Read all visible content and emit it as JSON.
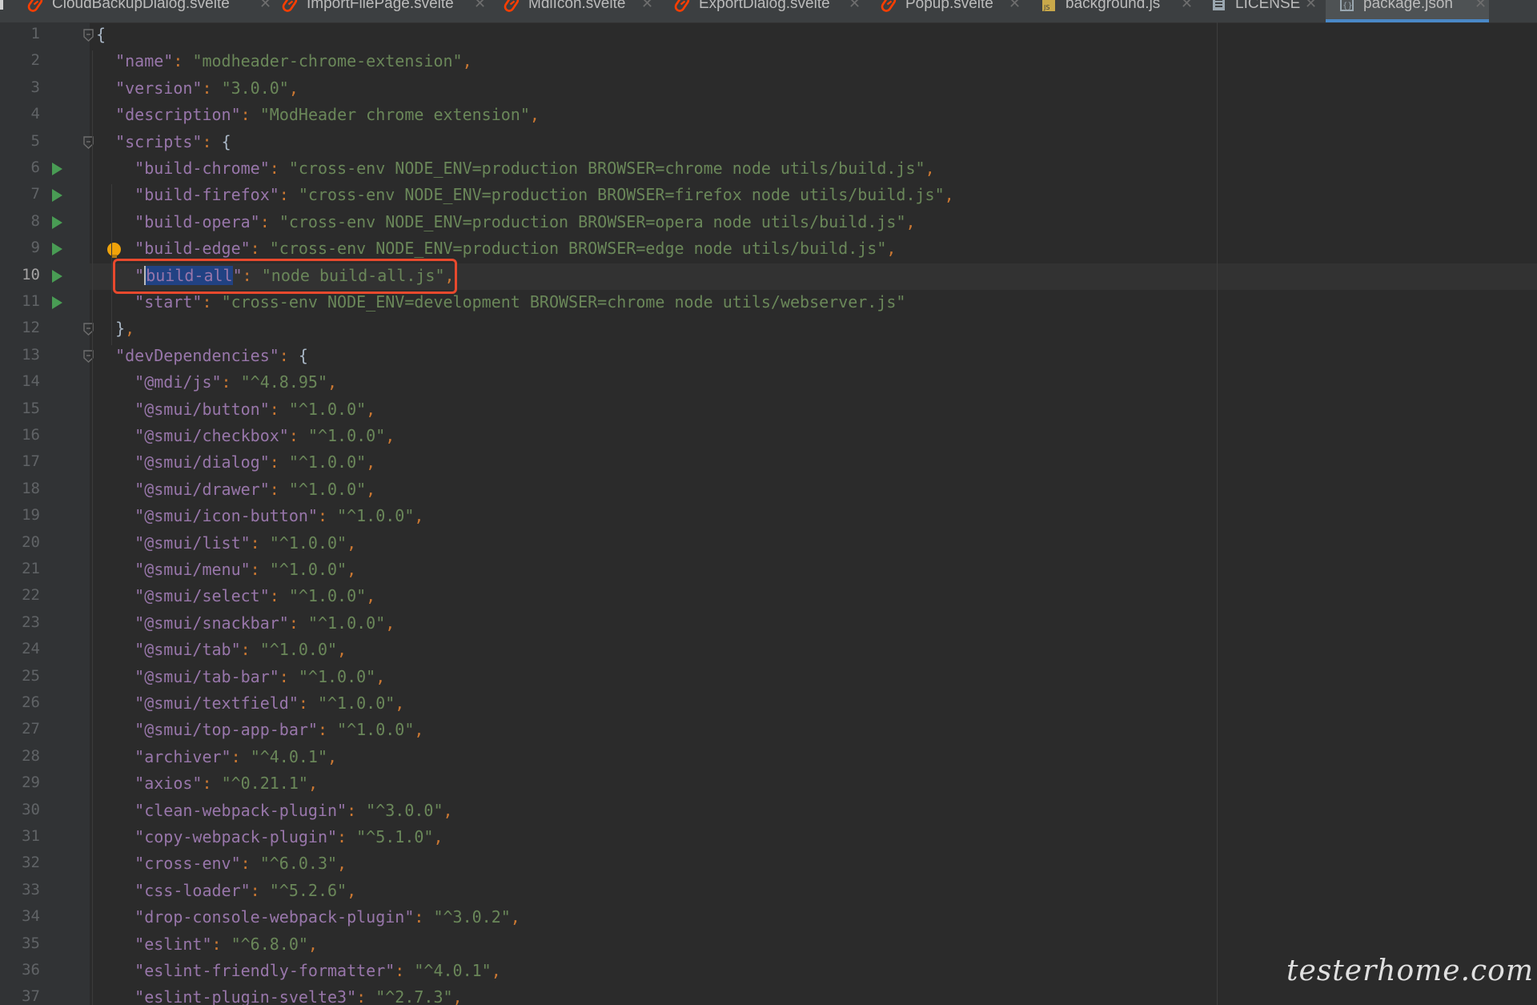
{
  "tabs": [
    {
      "label": "CloudBackupDialog.svelte",
      "icon": "svelte-icon",
      "active": false
    },
    {
      "label": "ImportFilePage.svelte",
      "icon": "svelte-icon",
      "active": false
    },
    {
      "label": "MdiIcon.svelte",
      "icon": "svelte-icon",
      "active": false
    },
    {
      "label": "ExportDialog.svelte",
      "icon": "svelte-icon",
      "active": false
    },
    {
      "label": "Popup.svelte",
      "icon": "svelte-icon",
      "active": false
    },
    {
      "label": "background.js",
      "icon": "javascript-file-icon",
      "active": false
    },
    {
      "label": "LICENSE",
      "icon": "text-file-icon",
      "active": false
    },
    {
      "label": "package.json",
      "icon": "json-file-icon",
      "active": true
    }
  ],
  "editor": {
    "current_line": 10,
    "selected_text": "build-all",
    "highlighted_line": 10,
    "lines": [
      {
        "n": "1",
        "fold": true,
        "tokens": [
          [
            "b",
            "{"
          ]
        ]
      },
      {
        "n": "2",
        "tokens": [
          [
            "i",
            "  "
          ],
          [
            "k",
            "\"name\""
          ],
          [
            "p",
            ": "
          ],
          [
            "s",
            "\"modheader-chrome-extension\""
          ],
          [
            "p",
            ","
          ]
        ]
      },
      {
        "n": "3",
        "tokens": [
          [
            "i",
            "  "
          ],
          [
            "k",
            "\"version\""
          ],
          [
            "p",
            ": "
          ],
          [
            "s",
            "\"3.0.0\""
          ],
          [
            "p",
            ","
          ]
        ]
      },
      {
        "n": "4",
        "tokens": [
          [
            "i",
            "  "
          ],
          [
            "k",
            "\"description\""
          ],
          [
            "p",
            ": "
          ],
          [
            "s",
            "\"ModHeader chrome extension\""
          ],
          [
            "p",
            ","
          ]
        ]
      },
      {
        "n": "5",
        "fold": true,
        "tokens": [
          [
            "i",
            "  "
          ],
          [
            "k",
            "\"scripts\""
          ],
          [
            "p",
            ": "
          ],
          [
            "b",
            "{"
          ]
        ]
      },
      {
        "n": "6",
        "run": true,
        "tokens": [
          [
            "i",
            "    "
          ],
          [
            "k",
            "\"build-chrome\""
          ],
          [
            "p",
            ": "
          ],
          [
            "s",
            "\"cross-env NODE_ENV=production BROWSER=chrome node utils/build.js\""
          ],
          [
            "p",
            ","
          ]
        ]
      },
      {
        "n": "7",
        "run": true,
        "tokens": [
          [
            "i",
            "    "
          ],
          [
            "k",
            "\"build-firefox\""
          ],
          [
            "p",
            ": "
          ],
          [
            "s",
            "\"cross-env NODE_ENV=production BROWSER=firefox node utils/build.js\""
          ],
          [
            "p",
            ","
          ]
        ]
      },
      {
        "n": "8",
        "run": true,
        "tokens": [
          [
            "i",
            "    "
          ],
          [
            "k",
            "\"build-opera\""
          ],
          [
            "p",
            ": "
          ],
          [
            "s",
            "\"cross-env NODE_ENV=production BROWSER=opera node utils/build.js\""
          ],
          [
            "p",
            ","
          ]
        ]
      },
      {
        "n": "9",
        "run": true,
        "bulb": true,
        "tokens": [
          [
            "i",
            "    "
          ],
          [
            "k",
            "\"build-edge\""
          ],
          [
            "p",
            ": "
          ],
          [
            "s",
            "\"cross-env NODE_ENV=production BROWSER=edge node utils/build.js\""
          ],
          [
            "p",
            ","
          ]
        ]
      },
      {
        "n": "10",
        "run": true,
        "tokens": [
          [
            "i",
            "    "
          ],
          [
            "k",
            "\""
          ],
          [
            "sel",
            "build-all"
          ],
          [
            "k",
            "\""
          ],
          [
            "p",
            ": "
          ],
          [
            "s",
            "\"node build-all.js\""
          ],
          [
            "p",
            ","
          ]
        ]
      },
      {
        "n": "11",
        "run": true,
        "tokens": [
          [
            "i",
            "    "
          ],
          [
            "k",
            "\"start\""
          ],
          [
            "p",
            ": "
          ],
          [
            "s",
            "\"cross-env NODE_ENV=development BROWSER=chrome node utils/webserver.js\""
          ]
        ]
      },
      {
        "n": "12",
        "fold": true,
        "tokens": [
          [
            "i",
            "  "
          ],
          [
            "b",
            "}"
          ],
          [
            "p",
            ","
          ]
        ]
      },
      {
        "n": "13",
        "fold": true,
        "tokens": [
          [
            "i",
            "  "
          ],
          [
            "k",
            "\"devDependencies\""
          ],
          [
            "p",
            ": "
          ],
          [
            "b",
            "{"
          ]
        ]
      },
      {
        "n": "14",
        "tokens": [
          [
            "i",
            "    "
          ],
          [
            "k",
            "\"@mdi/js\""
          ],
          [
            "p",
            ": "
          ],
          [
            "s",
            "\"^4.8.95\""
          ],
          [
            "p",
            ","
          ]
        ]
      },
      {
        "n": "15",
        "tokens": [
          [
            "i",
            "    "
          ],
          [
            "k",
            "\"@smui/button\""
          ],
          [
            "p",
            ": "
          ],
          [
            "s",
            "\"^1.0.0\""
          ],
          [
            "p",
            ","
          ]
        ]
      },
      {
        "n": "16",
        "tokens": [
          [
            "i",
            "    "
          ],
          [
            "k",
            "\"@smui/checkbox\""
          ],
          [
            "p",
            ": "
          ],
          [
            "s",
            "\"^1.0.0\""
          ],
          [
            "p",
            ","
          ]
        ]
      },
      {
        "n": "17",
        "tokens": [
          [
            "i",
            "    "
          ],
          [
            "k",
            "\"@smui/dialog\""
          ],
          [
            "p",
            ": "
          ],
          [
            "s",
            "\"^1.0.0\""
          ],
          [
            "p",
            ","
          ]
        ]
      },
      {
        "n": "18",
        "tokens": [
          [
            "i",
            "    "
          ],
          [
            "k",
            "\"@smui/drawer\""
          ],
          [
            "p",
            ": "
          ],
          [
            "s",
            "\"^1.0.0\""
          ],
          [
            "p",
            ","
          ]
        ]
      },
      {
        "n": "19",
        "tokens": [
          [
            "i",
            "    "
          ],
          [
            "k",
            "\"@smui/icon-button\""
          ],
          [
            "p",
            ": "
          ],
          [
            "s",
            "\"^1.0.0\""
          ],
          [
            "p",
            ","
          ]
        ]
      },
      {
        "n": "20",
        "tokens": [
          [
            "i",
            "    "
          ],
          [
            "k",
            "\"@smui/list\""
          ],
          [
            "p",
            ": "
          ],
          [
            "s",
            "\"^1.0.0\""
          ],
          [
            "p",
            ","
          ]
        ]
      },
      {
        "n": "21",
        "tokens": [
          [
            "i",
            "    "
          ],
          [
            "k",
            "\"@smui/menu\""
          ],
          [
            "p",
            ": "
          ],
          [
            "s",
            "\"^1.0.0\""
          ],
          [
            "p",
            ","
          ]
        ]
      },
      {
        "n": "22",
        "tokens": [
          [
            "i",
            "    "
          ],
          [
            "k",
            "\"@smui/select\""
          ],
          [
            "p",
            ": "
          ],
          [
            "s",
            "\"^1.0.0\""
          ],
          [
            "p",
            ","
          ]
        ]
      },
      {
        "n": "23",
        "tokens": [
          [
            "i",
            "    "
          ],
          [
            "k",
            "\"@smui/snackbar\""
          ],
          [
            "p",
            ": "
          ],
          [
            "s",
            "\"^1.0.0\""
          ],
          [
            "p",
            ","
          ]
        ]
      },
      {
        "n": "24",
        "tokens": [
          [
            "i",
            "    "
          ],
          [
            "k",
            "\"@smui/tab\""
          ],
          [
            "p",
            ": "
          ],
          [
            "s",
            "\"^1.0.0\""
          ],
          [
            "p",
            ","
          ]
        ]
      },
      {
        "n": "25",
        "tokens": [
          [
            "i",
            "    "
          ],
          [
            "k",
            "\"@smui/tab-bar\""
          ],
          [
            "p",
            ": "
          ],
          [
            "s",
            "\"^1.0.0\""
          ],
          [
            "p",
            ","
          ]
        ]
      },
      {
        "n": "26",
        "tokens": [
          [
            "i",
            "    "
          ],
          [
            "k",
            "\"@smui/textfield\""
          ],
          [
            "p",
            ": "
          ],
          [
            "s",
            "\"^1.0.0\""
          ],
          [
            "p",
            ","
          ]
        ]
      },
      {
        "n": "27",
        "tokens": [
          [
            "i",
            "    "
          ],
          [
            "k",
            "\"@smui/top-app-bar\""
          ],
          [
            "p",
            ": "
          ],
          [
            "s",
            "\"^1.0.0\""
          ],
          [
            "p",
            ","
          ]
        ]
      },
      {
        "n": "28",
        "tokens": [
          [
            "i",
            "    "
          ],
          [
            "k",
            "\"archiver\""
          ],
          [
            "p",
            ": "
          ],
          [
            "s",
            "\"^4.0.1\""
          ],
          [
            "p",
            ","
          ]
        ]
      },
      {
        "n": "29",
        "tokens": [
          [
            "i",
            "    "
          ],
          [
            "k",
            "\"axios\""
          ],
          [
            "p",
            ": "
          ],
          [
            "s",
            "\"^0.21.1\""
          ],
          [
            "p",
            ","
          ]
        ]
      },
      {
        "n": "30",
        "tokens": [
          [
            "i",
            "    "
          ],
          [
            "k",
            "\"clean-webpack-plugin\""
          ],
          [
            "p",
            ": "
          ],
          [
            "s",
            "\"^3.0.0\""
          ],
          [
            "p",
            ","
          ]
        ]
      },
      {
        "n": "31",
        "tokens": [
          [
            "i",
            "    "
          ],
          [
            "k",
            "\"copy-webpack-plugin\""
          ],
          [
            "p",
            ": "
          ],
          [
            "s",
            "\"^5.1.0\""
          ],
          [
            "p",
            ","
          ]
        ]
      },
      {
        "n": "32",
        "tokens": [
          [
            "i",
            "    "
          ],
          [
            "k",
            "\"cross-env\""
          ],
          [
            "p",
            ": "
          ],
          [
            "s",
            "\"^6.0.3\""
          ],
          [
            "p",
            ","
          ]
        ]
      },
      {
        "n": "33",
        "tokens": [
          [
            "i",
            "    "
          ],
          [
            "k",
            "\"css-loader\""
          ],
          [
            "p",
            ": "
          ],
          [
            "s",
            "\"^5.2.6\""
          ],
          [
            "p",
            ","
          ]
        ]
      },
      {
        "n": "34",
        "tokens": [
          [
            "i",
            "    "
          ],
          [
            "k",
            "\"drop-console-webpack-plugin\""
          ],
          [
            "p",
            ": "
          ],
          [
            "s",
            "\"^3.0.2\""
          ],
          [
            "p",
            ","
          ]
        ]
      },
      {
        "n": "35",
        "tokens": [
          [
            "i",
            "    "
          ],
          [
            "k",
            "\"eslint\""
          ],
          [
            "p",
            ": "
          ],
          [
            "s",
            "\"^6.8.0\""
          ],
          [
            "p",
            ","
          ]
        ]
      },
      {
        "n": "36",
        "tokens": [
          [
            "i",
            "    "
          ],
          [
            "k",
            "\"eslint-friendly-formatter\""
          ],
          [
            "p",
            ": "
          ],
          [
            "s",
            "\"^4.0.1\""
          ],
          [
            "p",
            ","
          ]
        ]
      },
      {
        "n": "37",
        "tokens": [
          [
            "i",
            "    "
          ],
          [
            "k",
            "\"eslint-plugin-svelte3\""
          ],
          [
            "p",
            ": "
          ],
          [
            "s",
            "\"^2.7.3\""
          ],
          [
            "p",
            ","
          ]
        ]
      }
    ]
  },
  "watermark": "testerhome.com",
  "colors": {
    "background": "#2b2b2b",
    "gutter": "#313335",
    "key": "#9876aa",
    "string": "#6a8759",
    "punctuation": "#cc7832",
    "selection": "#214283",
    "active_tab_underline": "#4a88c7",
    "annotation_box": "#e8492d",
    "run_icon": "#499c54"
  }
}
